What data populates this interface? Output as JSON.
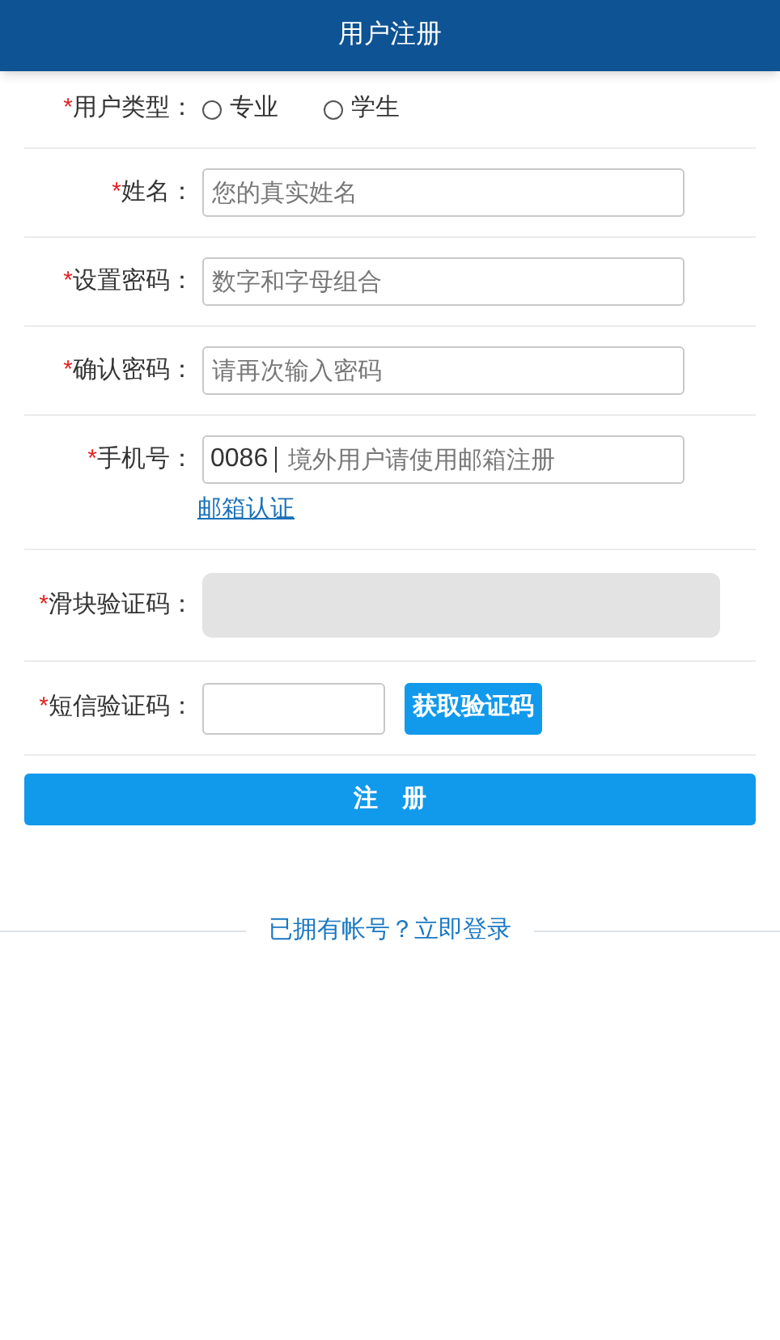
{
  "header": {
    "title": "用户注册"
  },
  "fields": [
    {
      "kind": "radio",
      "mark": "*",
      "label": "用户类型：",
      "options": [
        {
          "label": "专业",
          "selected": false
        },
        {
          "label": "学生",
          "selected": false
        }
      ]
    },
    {
      "kind": "text",
      "mark": "*",
      "label": "姓名：",
      "placeholder": "您的真实姓名"
    },
    {
      "kind": "text",
      "mark": "*",
      "label": "设置密码：",
      "placeholder": "数字和字母组合"
    },
    {
      "kind": "text",
      "mark": "*",
      "label": "确认密码：",
      "placeholder": "请再次输入密码"
    },
    {
      "kind": "phone",
      "mark": "*",
      "label": "手机号：",
      "prefix": "0086",
      "placeholder": "境外用户请使用邮箱注册",
      "link": "邮箱认证"
    },
    {
      "kind": "slider",
      "mark": "*",
      "label": "滑块验证码："
    },
    {
      "kind": "sms",
      "mark": "*",
      "label": "短信验证码：",
      "button": "获取验证码"
    }
  ],
  "submit": "注　册",
  "login_link": "已拥有帐号？立即登录"
}
